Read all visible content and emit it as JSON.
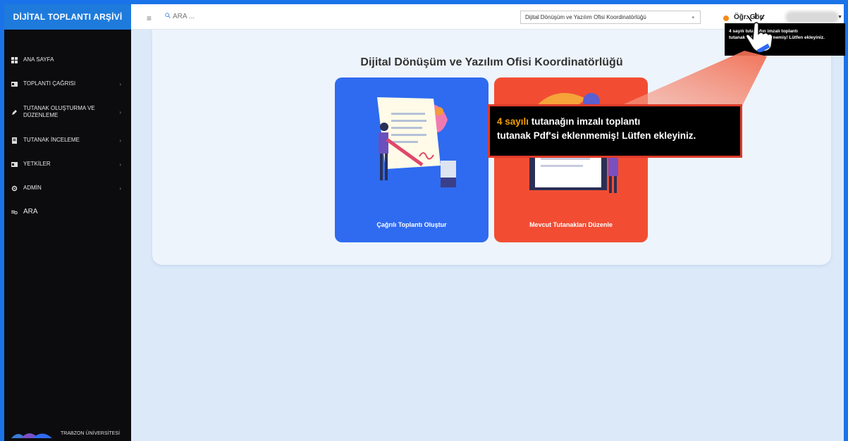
{
  "sidebar": {
    "title": "DİJİTAL TOPLANTI ARŞİVİ",
    "items": [
      {
        "label": "ANA SAYFA",
        "icon": "grid-icon",
        "chevron": false
      },
      {
        "label": "TOPLANTI ÇAĞRISI",
        "icon": "card-icon",
        "chevron": true
      },
      {
        "label": "TUTANAK OLUŞTURMA VE DÜZENLEME",
        "icon": "pen-icon",
        "chevron": true
      },
      {
        "label": "TUTANAK İNCELEME",
        "icon": "doc-icon",
        "chevron": true
      },
      {
        "label": "YETKİLER",
        "icon": "card-icon",
        "chevron": true
      },
      {
        "label": "ADMİN",
        "icon": "gear-icon",
        "chevron": true
      },
      {
        "label": "ARA",
        "icon": "search-list-icon",
        "chevron": false
      }
    ],
    "footer": "TRABZON ÜNİVERSİTESİ"
  },
  "topbar": {
    "search_placeholder": "ARA ...",
    "org_selected": "Dijital Dönüşüm ve Yazılım Ofisi Koordinatörlüğü",
    "user_label": "Öğr. Gör."
  },
  "main": {
    "title": "Dijital Dönüşüm ve Yazılım Ofisi Koordinatörlüğü",
    "tiles": [
      {
        "label": "Çağrılı Toplantı Oluştur"
      },
      {
        "label": "Mevcut Tutanakları Düzenle"
      }
    ]
  },
  "notification": {
    "number": "4 sayılı",
    "line1_rest": " tutanağın imzalı toplantı",
    "line2": "tutanak Pdf'si eklenmemiş! Lütfen ekleyiniz.",
    "small_line1": "4 sayılı tutanağın imzalı toplantı",
    "small_line2": "tutanak Pdf'si eklenmemiş! Lütfen ekleyiniz."
  },
  "colors": {
    "sidebar_bg": "#0c0c0e",
    "sidebar_header": "#1e7bdc",
    "tile_blue": "#2f6bf0",
    "tile_red": "#f24d33",
    "highlight": "#f4a000",
    "callout_border": "#e03b2a"
  }
}
